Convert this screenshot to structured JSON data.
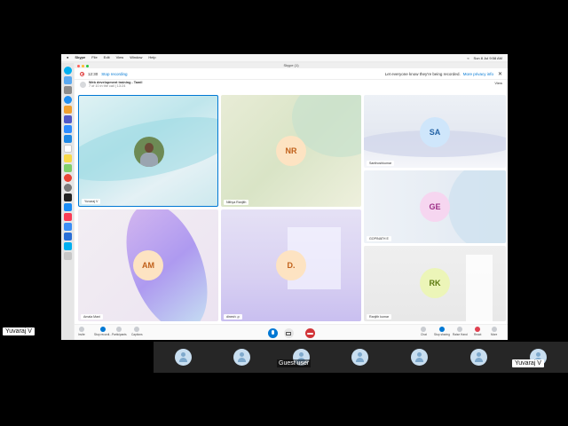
{
  "menubar": {
    "app_name": "Skype",
    "items": [
      "File",
      "Edit",
      "View",
      "Window",
      "Help"
    ],
    "clock": "Sun 8 Jul  9:58 AM"
  },
  "dock": {
    "icons": [
      "skype-icon",
      "finder-icon",
      "launchpad-icon",
      "safari-icon",
      "photos-icon",
      "teams-icon",
      "zoom-icon",
      "vscode-icon",
      "calendar-icon",
      "notes-icon",
      "maps-icon",
      "chrome-icon",
      "settings-icon",
      "terminal-icon",
      "appstore-icon",
      "music-icon",
      "keynote-icon",
      "xcode-icon",
      "skype-icon-2",
      "trash-icon"
    ]
  },
  "window": {
    "title": "Skype (1)"
  },
  "recording": {
    "timer": "12:30",
    "stop_label": "Stop recording",
    "notice": "Let everyone know they're being recorded.",
    "privacy_label": "More privacy info",
    "close": "✕"
  },
  "call": {
    "title": "Web development training - Tamil",
    "subtitle": "7 of 10 in the call | 13:24",
    "view_label": "View"
  },
  "tiles": [
    {
      "name": "Yuvaraj V",
      "avatar": "",
      "is_video": true
    },
    {
      "name": "Nithya Ranjith",
      "avatar": "NR"
    },
    {
      "name": "Santhoshkumar",
      "avatar": "SA"
    },
    {
      "name": "GOPINATH E",
      "avatar": "GE"
    },
    {
      "name": "Amala Mani",
      "avatar": "AM"
    },
    {
      "name": "dinesh .p",
      "avatar": "D."
    },
    {
      "name": "Ranjith kumar",
      "avatar": "RK"
    }
  ],
  "controls": {
    "left": [
      "Invite",
      "Stop recordi...",
      "Participants",
      "Captions"
    ],
    "right": [
      "Chat",
      "Stop sharing",
      "Raise Hand",
      "React",
      "More"
    ]
  },
  "meeting": {
    "left_name": "Yuvaraj V",
    "guest_label": "Guest user",
    "right_name": "Yuvaraj V",
    "participant_count": 7
  },
  "colors": {
    "skype_blue": "#0078d4",
    "end_call_red": "#d13438",
    "avatar_bubble": "#fde3c2"
  }
}
